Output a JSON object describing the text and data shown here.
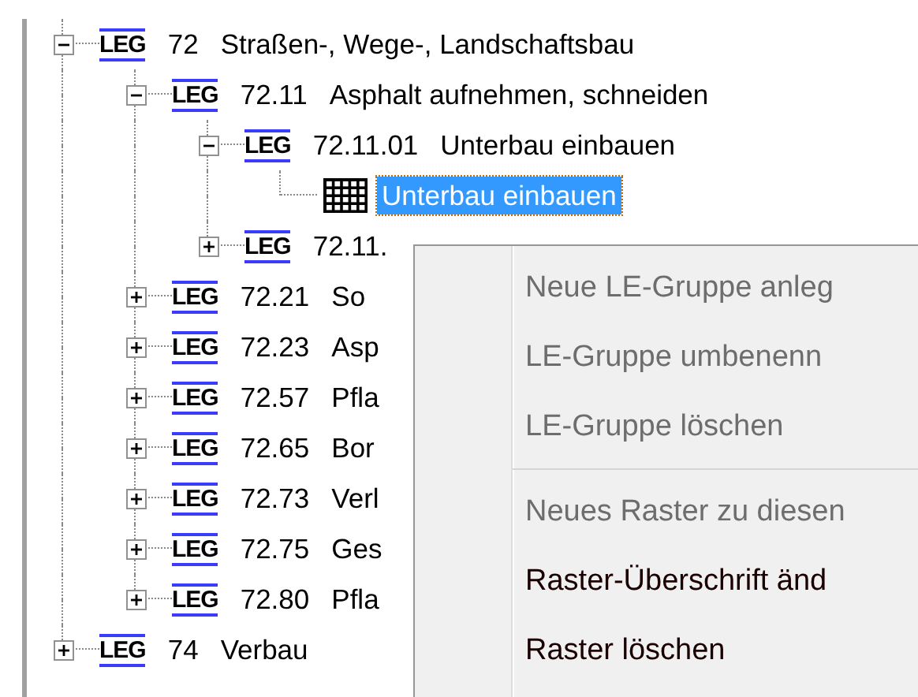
{
  "tree": [
    {
      "kind": "group",
      "badge": "LEG",
      "code": "72",
      "title": "Straßen-, Wege-, Landschaftsbau",
      "expanded": true,
      "selected": false,
      "children": [
        {
          "kind": "group",
          "badge": "LEG",
          "code": "72.11",
          "title": "Asphalt aufnehmen, schneiden",
          "expanded": true,
          "selected": false,
          "children": [
            {
              "kind": "group",
              "badge": "LEG",
              "code": "72.11.01",
              "title": "Unterbau einbauen",
              "expanded": true,
              "selected": false,
              "children": [
                {
                  "kind": "grid",
                  "label": "Unterbau einbauen",
                  "selected": true
                }
              ]
            },
            {
              "kind": "group",
              "badge": "LEG",
              "code": "72.11.",
              "expanded": false,
              "selected": false
            }
          ]
        },
        {
          "kind": "group",
          "badge": "LEG",
          "code": "72.21",
          "title": "So",
          "expanded": false,
          "selected": false
        },
        {
          "kind": "group",
          "badge": "LEG",
          "code": "72.23",
          "title": "Asp",
          "expanded": false,
          "selected": false
        },
        {
          "kind": "group",
          "badge": "LEG",
          "code": "72.57",
          "title": "Pfla",
          "expanded": false,
          "selected": false
        },
        {
          "kind": "group",
          "badge": "LEG",
          "code": "72.65",
          "title": "Bor",
          "expanded": false,
          "selected": false
        },
        {
          "kind": "group",
          "badge": "LEG",
          "code": "72.73",
          "title": "Verl",
          "expanded": false,
          "selected": false
        },
        {
          "kind": "group",
          "badge": "LEG",
          "code": "72.75",
          "title": "Ges",
          "expanded": false,
          "selected": false
        },
        {
          "kind": "group",
          "badge": "LEG",
          "code": "72.80",
          "title": "Pfla",
          "expanded": false,
          "selected": false
        }
      ]
    },
    {
      "kind": "group",
      "badge": "LEG",
      "code": "74",
      "title": "Verbau",
      "expanded": false,
      "selected": false
    }
  ],
  "context_menu": {
    "items": [
      {
        "kind": "item",
        "label": "Neue LE-Gruppe anleg",
        "disabled": true
      },
      {
        "kind": "item",
        "label": "LE-Gruppe umbenenn",
        "disabled": true
      },
      {
        "kind": "item",
        "label": "LE-Gruppe löschen",
        "disabled": true
      },
      {
        "kind": "separator"
      },
      {
        "kind": "item",
        "label": "Neues Raster zu diesen",
        "disabled": true
      },
      {
        "kind": "item",
        "label": "Raster-Überschrift änd",
        "disabled": false
      },
      {
        "kind": "item",
        "label": "Raster löschen",
        "disabled": false
      }
    ]
  }
}
